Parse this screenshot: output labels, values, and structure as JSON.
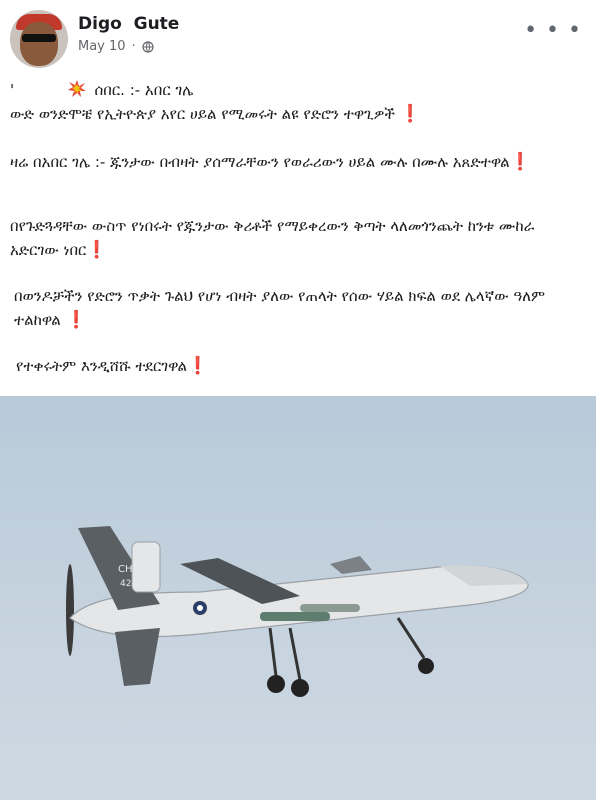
{
  "post": {
    "author": "Digo  Gute",
    "date": "May 10",
    "separator": "·",
    "lines": {
      "tick": "'",
      "headline": "ሰበር. :-  አበር ገሌ",
      "intro": "ውድ ወንድሞቼ የኢትዮጵያ አየር ሀይል የሚመሩት ልዩ የድሮን  ተዋጊዎች ",
      "p2": "ዛሬ በአበር ገሌ :- ጁንታው በብዛት ያሰማራቸውን የወራሪውን ሀይል  ሙሉ በሙሉ አጸድተዋል",
      "p3": "በየጉድጓዳቸው ውስጥ የነበሩት የጁንታው ቅሪቶች የማይቀረውን ቅጣት ላለመጎንጨት ከንቱ ሙከራ አድርገው ነበር",
      "p4": "በወንዶቻችን የድሮን ጥቃት ጉልህ የሆነ ብዛት ያለው የጠላት የሰው ሃይል ክፍል ወደ ሌላኛው ዓለም ተልከዋል ",
      "p5": "የተቀሩትም እንዲሸሹ ተደርገዋል"
    },
    "exclamation": "❗"
  },
  "icons": {
    "collision": "collision-icon",
    "privacy": "globe-icon",
    "menu": "more-options-icon",
    "avatar": "avatar"
  },
  "colors": {
    "exclamation": "#e0141e",
    "meta": "#65676b",
    "sky": "#c7d4df",
    "drone_body": "#e4e6e8"
  },
  "image": {
    "subject": "drone",
    "tail_text": "CH",
    "tail_number": "4242"
  }
}
